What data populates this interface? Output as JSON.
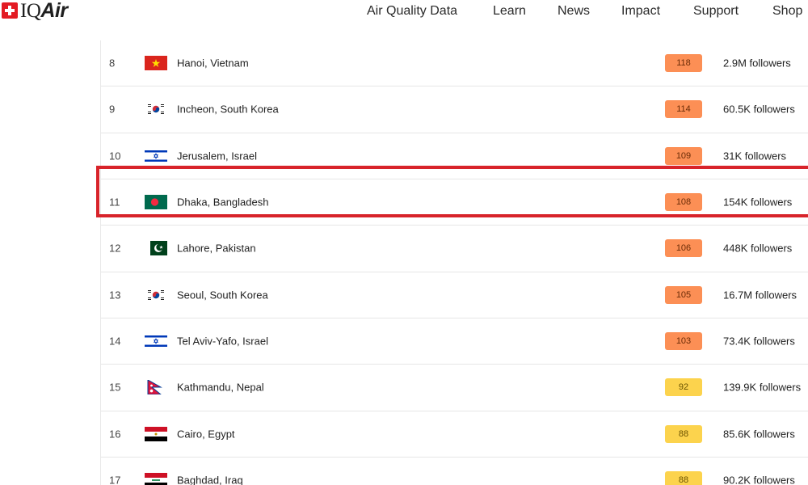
{
  "header": {
    "logo": {
      "prefix": "IQ",
      "suffix": "Air"
    },
    "nav": [
      {
        "label": "Air Quality Data"
      },
      {
        "label": "Learn"
      },
      {
        "label": "News"
      },
      {
        "label": "Impact"
      },
      {
        "label": "Support"
      },
      {
        "label": "Shop"
      }
    ]
  },
  "colors": {
    "highlight": "#d8232a",
    "aqi_orange": "#fc8f55",
    "aqi_yellow": "#fcd34d",
    "logo_red": "#e31b23"
  },
  "rows": [
    {
      "rank": "8",
      "city": "Hanoi, Vietnam",
      "flag": "vietnam-flag-icon",
      "aqi": "118",
      "level": "orange",
      "followers": "2.9M followers"
    },
    {
      "rank": "9",
      "city": "Incheon, South Korea",
      "flag": "south-korea-flag-icon",
      "aqi": "114",
      "level": "orange",
      "followers": "60.5K followers"
    },
    {
      "rank": "10",
      "city": "Jerusalem, Israel",
      "flag": "israel-flag-icon",
      "aqi": "109",
      "level": "orange",
      "followers": "31K followers"
    },
    {
      "rank": "11",
      "city": "Dhaka, Bangladesh",
      "flag": "bangladesh-flag-icon",
      "aqi": "108",
      "level": "orange",
      "followers": "154K followers",
      "highlighted": true
    },
    {
      "rank": "12",
      "city": "Lahore, Pakistan",
      "flag": "pakistan-flag-icon",
      "aqi": "106",
      "level": "orange",
      "followers": "448K followers"
    },
    {
      "rank": "13",
      "city": "Seoul, South Korea",
      "flag": "south-korea-flag-icon",
      "aqi": "105",
      "level": "orange",
      "followers": "16.7M followers"
    },
    {
      "rank": "14",
      "city": "Tel Aviv-Yafo, Israel",
      "flag": "israel-flag-icon",
      "aqi": "103",
      "level": "orange",
      "followers": "73.4K followers"
    },
    {
      "rank": "15",
      "city": "Kathmandu, Nepal",
      "flag": "nepal-flag-icon",
      "aqi": "92",
      "level": "yellow",
      "followers": "139.9K followers"
    },
    {
      "rank": "16",
      "city": "Cairo, Egypt",
      "flag": "egypt-flag-icon",
      "aqi": "88",
      "level": "yellow",
      "followers": "85.6K followers"
    },
    {
      "rank": "17",
      "city": "Baghdad, Iraq",
      "flag": "iraq-flag-icon",
      "aqi": "88",
      "level": "yellow",
      "followers": "90.2K followers"
    }
  ]
}
